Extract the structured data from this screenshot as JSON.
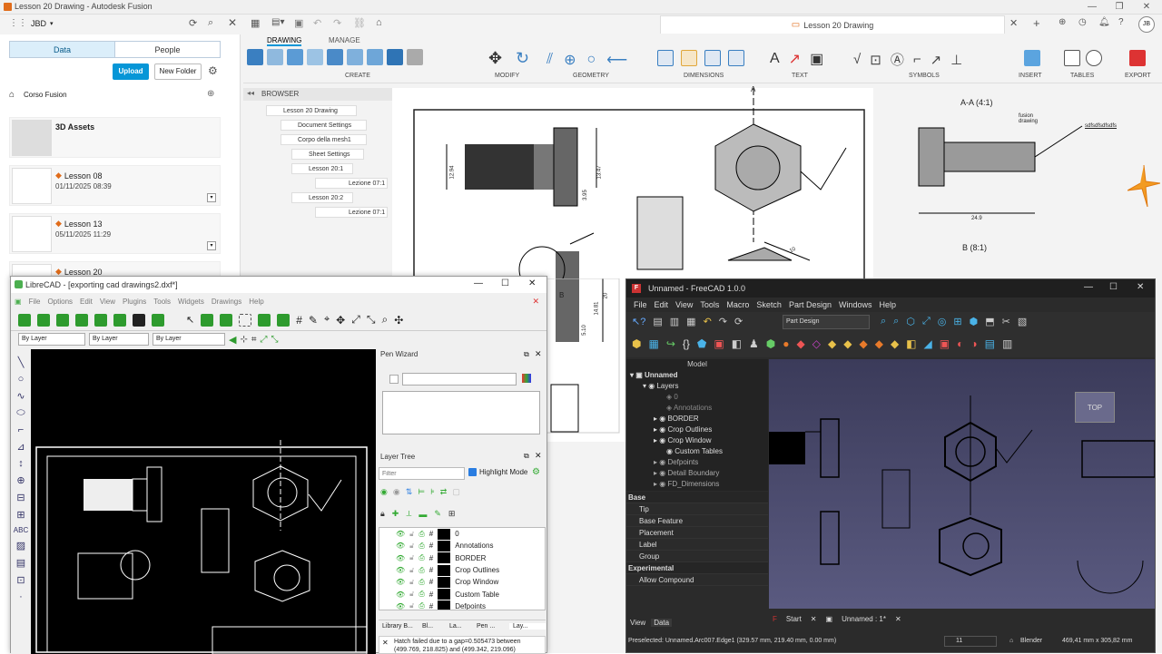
{
  "fusion": {
    "window_title": "Lesson 20 Drawing - Autodesk Fusion",
    "workspace": "JBD",
    "doc_tab": "Lesson 20 Drawing",
    "user_initials": "JB",
    "data_tabs": [
      "Data",
      "People"
    ],
    "upload_label": "Upload",
    "new_folder_label": "New Folder",
    "breadcrumb": "Corso Fusion",
    "files": [
      {
        "name": "3D Assets",
        "date": ""
      },
      {
        "name": "Lesson 08",
        "date": "01/11/2025 08:39"
      },
      {
        "name": "Lesson 13",
        "date": "05/11/2025 11:29"
      },
      {
        "name": "Lesson 20",
        "date": ""
      }
    ],
    "ribbon_tabs": [
      "DRAWING",
      "MANAGE"
    ],
    "ribbon_groups": [
      "CREATE",
      "MODIFY",
      "GEOMETRY",
      "DIMENSIONS",
      "TEXT",
      "SYMBOLS",
      "INSERT",
      "TABLES",
      "EXPORT"
    ],
    "browser_title": "BROWSER",
    "browser_items": [
      "Lesson 20 Drawing",
      "Document Settings",
      "Corpo della mesh1",
      "Sheet Settings",
      "Lesson 20:1",
      "Lezione 07:1",
      "Lesson 20:2",
      "Lezione 07:1"
    ],
    "drawing_labels": {
      "section_a": "A-A (4:1)",
      "detail_b": "B (8:1)",
      "fusion_drawing": "fusion\ndrawing",
      "leader_text": "sdfsdfsdfsdfs",
      "dim_24_9": "24.9",
      "dim_12_94": "12.94",
      "dim_13_47": "13.47",
      "dim_3_95": "3.95",
      "dim_10": "10",
      "dim_20": "20",
      "dim_14_81": "14.81",
      "dim_5_10": "5.10",
      "letter_a": "A",
      "letter_b": "B"
    }
  },
  "librecad": {
    "title": "LibreCAD - [exporting cad drawings2.dxf*]",
    "menu": [
      "File",
      "Options",
      "Edit",
      "View",
      "Plugins",
      "Tools",
      "Widgets",
      "Drawings",
      "Help"
    ],
    "combos": [
      "By Layer",
      "By Layer",
      "By Layer"
    ],
    "pen_wizard": "Pen Wizard",
    "layer_tree": "Layer Tree",
    "filter_placeholder": "Filter",
    "highlight_mode": "Highlight Mode",
    "layers": [
      "0",
      "Annotations",
      "BORDER",
      "Crop Outlines",
      "Crop Window",
      "Custom Table",
      "Defpoints"
    ],
    "bottom_tabs": [
      "Library B...",
      "Bl...",
      "La...",
      "Pen ...",
      "Lay..."
    ],
    "message": "Hatch failed due to a gap=0.505473 between (499.769, 218.825) and (499.342, 219.096)"
  },
  "freecad": {
    "title": "Unnamed - FreeCAD 1.0.0",
    "menu": [
      "File",
      "Edit",
      "View",
      "Tools",
      "Macro",
      "Sketch",
      "Part Design",
      "Windows",
      "Help"
    ],
    "workbench": "Part Design",
    "tree_header": "Model",
    "tree": [
      "Unnamed",
      "Layers",
      "0",
      "Annotations",
      "BORDER",
      "Crop Outlines",
      "Crop Window",
      "Custom Tables",
      "Defpoints",
      "Detail Boundary",
      "FD_Dimensions"
    ],
    "prop_groups": {
      "base": "Base",
      "base_items": [
        "Tip",
        "Base Feature",
        "Placement",
        "Label",
        "Group"
      ],
      "experimental": "Experimental",
      "exp_items": [
        "Allow Compound"
      ]
    },
    "panel_tabs": [
      "View",
      "Data"
    ],
    "doc_tabs": [
      "Start",
      "Unnamed : 1*"
    ],
    "nav_cube": "TOP",
    "status_text": "Preselected: Unnamed.Arc007.Edge1 (329.57 mm, 219.40 mm, 0.00 mm)",
    "status_num": "11",
    "nav_style": "Blender",
    "dims": "469,41 mm x 305,82 mm"
  }
}
